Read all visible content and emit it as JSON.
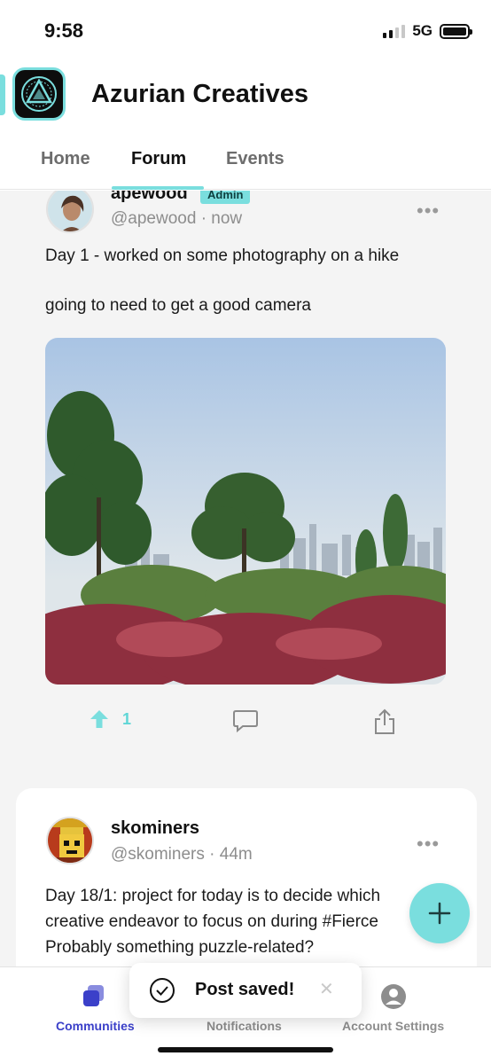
{
  "status_bar": {
    "time": "9:58",
    "network": "5G"
  },
  "header": {
    "title": "Azurian Creatives"
  },
  "tabs": [
    {
      "label": "Home"
    },
    {
      "label": "Forum"
    },
    {
      "label": "Events"
    }
  ],
  "active_tab": "Forum",
  "posts": [
    {
      "author": "apewood",
      "badge": "Admin",
      "handle": "@apewood · now",
      "lines": [
        "Day 1 - worked on some photography on a hike",
        "going to need to get a good camera"
      ],
      "upvotes": "1"
    },
    {
      "author": "skominers",
      "handle": "@skominers · 44m",
      "lines": [
        "Day 18/1: project for today is to decide which",
        "creative endeavor to focus on during #Fierce",
        "Probably something puzzle-related?"
      ]
    }
  ],
  "toast": {
    "message": "Post saved!"
  },
  "bottom_nav": [
    {
      "label": "Communities"
    },
    {
      "label": "Notifications"
    },
    {
      "label": "Account Settings"
    }
  ],
  "colors": {
    "accent": "#7adede",
    "active_nav": "#3b40c9",
    "toast_icon": "#111111"
  },
  "icons": [
    "signal-icon",
    "battery-icon",
    "upvote-icon",
    "comment-icon",
    "share-icon",
    "more-icon",
    "plus-icon",
    "communities-icon",
    "notifications-icon",
    "account-icon",
    "check-circle-icon",
    "close-icon"
  ]
}
